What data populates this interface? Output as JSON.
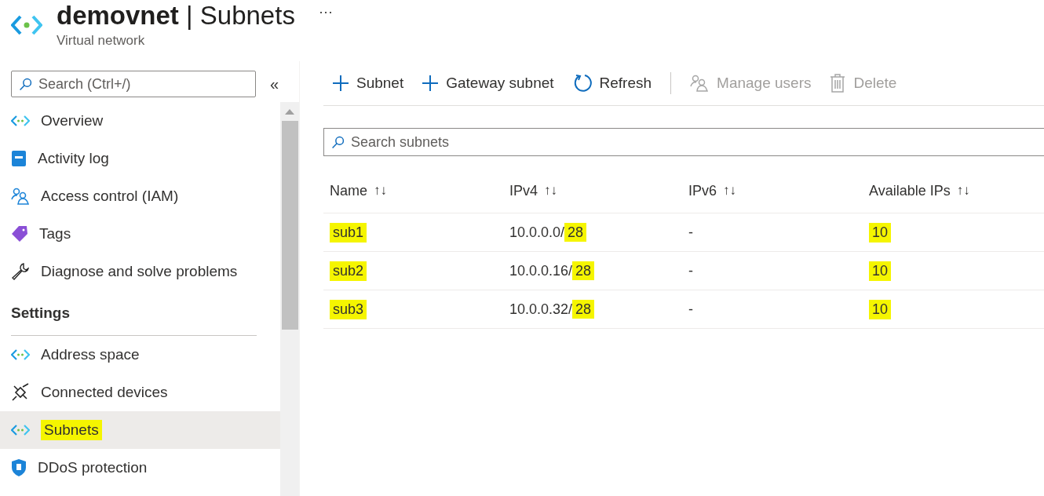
{
  "header": {
    "title": "demovnet",
    "divider": "|",
    "page": "Subnets",
    "subtitle": "Virtual network",
    "more": "···"
  },
  "sidebar": {
    "search": {
      "placeholder": "Search (Ctrl+/)"
    },
    "collapse": "«",
    "groups": [
      {
        "items": [
          {
            "kind": "network",
            "label": "Overview",
            "selected": false,
            "highlighted": false
          },
          {
            "kind": "log",
            "label": "Activity log",
            "selected": false,
            "highlighted": false
          },
          {
            "kind": "people",
            "label": "Access control (IAM)",
            "selected": false,
            "highlighted": false
          },
          {
            "kind": "tag",
            "label": "Tags",
            "selected": false,
            "highlighted": false
          },
          {
            "kind": "wrench",
            "label": "Diagnose and solve problems",
            "selected": false,
            "highlighted": false
          }
        ]
      },
      {
        "heading": "Settings",
        "items": [
          {
            "kind": "network",
            "label": "Address space",
            "selected": false,
            "highlighted": false
          },
          {
            "kind": "plug",
            "label": "Connected devices",
            "selected": false,
            "highlighted": false
          },
          {
            "kind": "network",
            "label": "Subnets",
            "selected": true,
            "highlighted": true
          },
          {
            "kind": "shield",
            "label": "DDoS protection",
            "selected": false,
            "highlighted": false
          }
        ]
      }
    ]
  },
  "toolbar": [
    {
      "kind": "plus",
      "label": "Subnet",
      "disabled": false
    },
    {
      "kind": "plus",
      "label": "Gateway subnet",
      "disabled": false
    },
    {
      "kind": "refresh",
      "label": "Refresh",
      "disabled": false
    },
    {
      "kind": "separator"
    },
    {
      "kind": "users",
      "label": "Manage users",
      "disabled": true
    },
    {
      "kind": "trash",
      "label": "Delete",
      "disabled": true
    }
  ],
  "search": {
    "placeholder": "Search subnets"
  },
  "table": {
    "columns": [
      {
        "label": "Name",
        "sort": "↑↓"
      },
      {
        "label": "IPv4",
        "sort": "↑↓"
      },
      {
        "label": "IPv6",
        "sort": "↑↓"
      },
      {
        "label": "Available IPs",
        "sort": "↑↓"
      }
    ],
    "rows": [
      {
        "name": "sub1",
        "ipv4_address": "10.0.0.0/",
        "ipv4_prefix": "28",
        "ipv6": "-",
        "available_ips": "10",
        "highlighted": true
      },
      {
        "name": "sub2",
        "ipv4_address": "10.0.0.16/",
        "ipv4_prefix": "28",
        "ipv6": "-",
        "available_ips": "10",
        "highlighted": true
      },
      {
        "name": "sub3",
        "ipv4_address": "10.0.0.32/",
        "ipv4_prefix": "28",
        "ipv6": "-",
        "available_ips": "10",
        "highlighted": true
      }
    ]
  }
}
